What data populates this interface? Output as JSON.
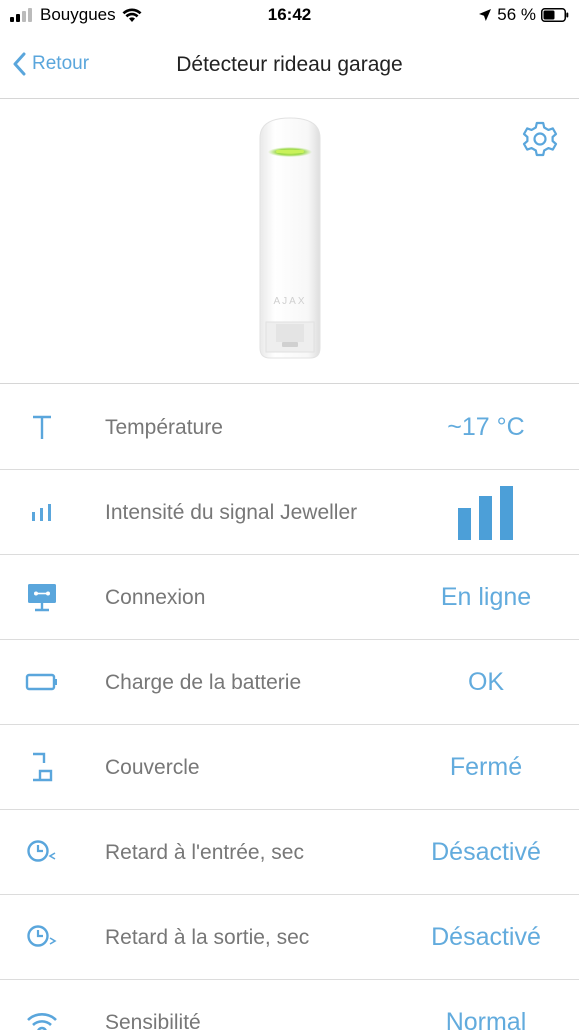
{
  "status_bar": {
    "carrier": "Bouygues",
    "time": "16:42",
    "battery_percent": "56 %"
  },
  "nav": {
    "back_label": "Retour",
    "title": "Détecteur rideau garage"
  },
  "device": {
    "brand_mark": "AJAX"
  },
  "rows": [
    {
      "icon": "thermometer-t-icon",
      "label": "Température",
      "value": "~17 °C"
    },
    {
      "icon": "signal-bars-icon",
      "label": "Intensité du signal Jeweller",
      "value_bars": 3
    },
    {
      "icon": "connection-monitor-icon",
      "label": "Connexion",
      "value": "En ligne"
    },
    {
      "icon": "battery-icon",
      "label": "Charge de la batterie",
      "value": "OK"
    },
    {
      "icon": "lid-icon",
      "label": "Couvercle",
      "value": "Fermé"
    },
    {
      "icon": "entry-delay-clock-icon",
      "label": "Retard à l'entrée, sec",
      "value": "Désactivé"
    },
    {
      "icon": "exit-delay-clock-icon",
      "label": "Retard à la sortie, sec",
      "value": "Désactivé"
    },
    {
      "icon": "sensitivity-wifi-icon",
      "label": "Sensibilité",
      "value": "Normal"
    }
  ],
  "colors": {
    "accent": "#5aa6dc",
    "label": "#777777",
    "divider": "#d6d6d6"
  }
}
